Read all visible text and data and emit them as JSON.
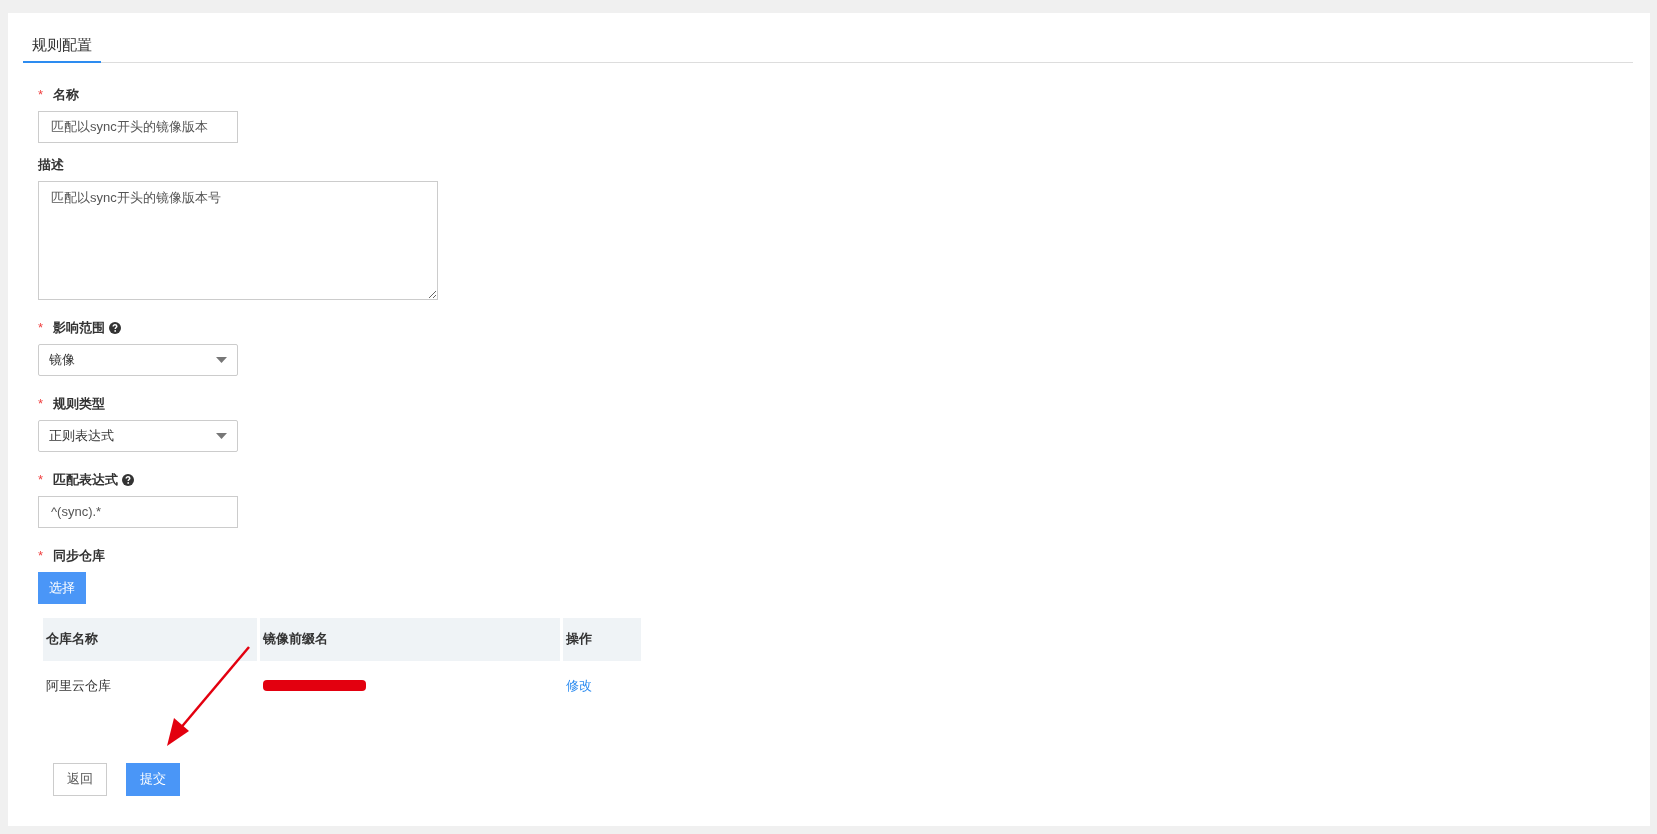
{
  "tabs": [
    {
      "label": "规则配置",
      "selected": true
    }
  ],
  "fields": [
    {
      "kind": "input",
      "label": "名称",
      "required": true,
      "help": false,
      "value": "匹配以sync开头的镜像版本"
    },
    {
      "kind": "textarea",
      "label": "描述",
      "required": false,
      "help": false,
      "value": "匹配以sync开头的镜像版本号"
    },
    {
      "kind": "select",
      "label": "影响范围",
      "required": true,
      "help": true,
      "value": "镜像"
    },
    {
      "kind": "select",
      "label": "规则类型",
      "required": true,
      "help": false,
      "value": "正则表达式"
    },
    {
      "kind": "input",
      "label": "匹配表达式",
      "required": true,
      "help": true,
      "value": "^(sync).*"
    },
    {
      "kind": "button",
      "label": "同步仓库",
      "required": true,
      "help": false,
      "value": "选择"
    }
  ],
  "required_mark": "*",
  "table": {
    "columns": [
      "仓库名称",
      "镜像前缀名",
      "操作"
    ],
    "rows": [
      {
        "name": "阿里云仓库",
        "prefix_redacted": true,
        "action": "修改"
      }
    ]
  },
  "buttons": [
    {
      "label": "返回",
      "primary": false
    },
    {
      "label": "提交",
      "primary": true
    }
  ]
}
